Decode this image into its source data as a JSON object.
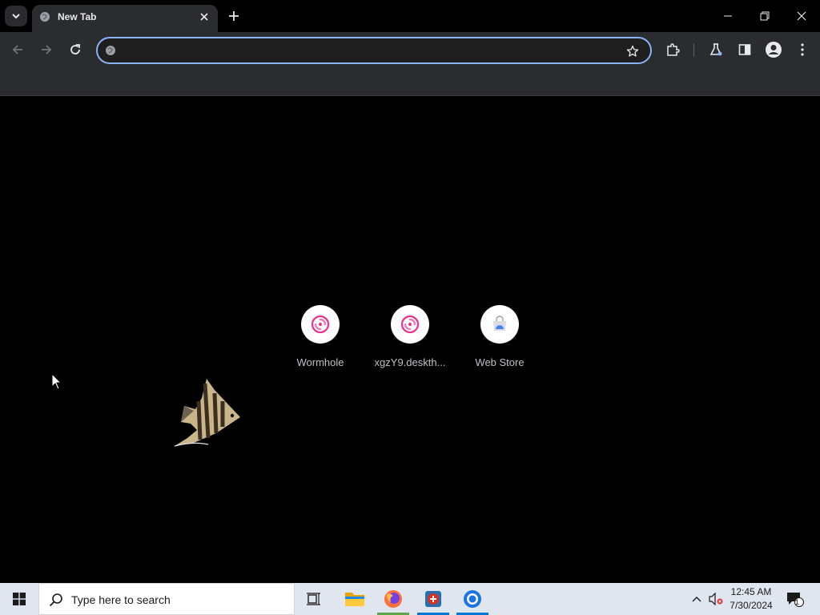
{
  "browser": {
    "tab_title": "New Tab",
    "omnibox_value": "",
    "omnibox_placeholder": ""
  },
  "shortcuts": [
    {
      "label": "Wormhole",
      "icon": "wormhole-icon"
    },
    {
      "label": "xgzY9.deskth...",
      "icon": "wormhole-icon"
    },
    {
      "label": "Web Store",
      "icon": "web-store-icon"
    }
  ],
  "taskbar": {
    "search_placeholder": "Type here to search",
    "time": "12:45 AM",
    "date": "7/30/2024",
    "notification_count": "1"
  },
  "colors": {
    "accent": "#8ab4f8",
    "toolbar": "#2b2c30",
    "page_background": "#000000",
    "shortcut_pink": "#e8318a"
  }
}
